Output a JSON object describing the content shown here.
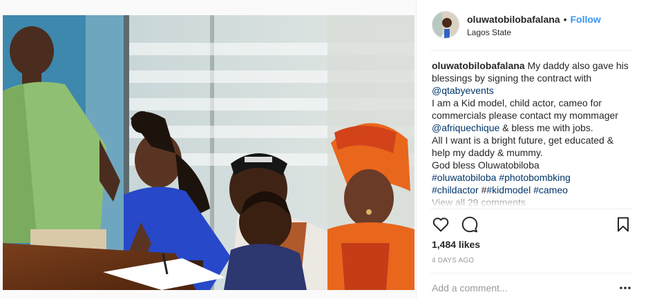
{
  "post": {
    "photo_description_icon": "photo-image",
    "header": {
      "username": "oluwatobilobafalana",
      "dot": "•",
      "follow_label": "Follow",
      "location": "Lagos State"
    },
    "caption": {
      "username": "oluwatobilobafalana",
      "text_1": " My daddy also gave his blessings by signing the contract with ",
      "mention_1": "@qtabyevents",
      "line_2": "I am a Kid model, child actor, cameo for commercials please contact my mommager ",
      "mention_2": "@afriquechique",
      "line_2_tail": " & bless me with jobs.",
      "line_3": "All I want is a bright future, get educated & help my daddy & mummy.",
      "line_4": "God bless Oluwatobiloba",
      "hashtag_1": "#oluwatobiloba",
      "hashtag_2": "#photobombking",
      "hashtag_3": "#childactor",
      "hash_prefix": "#",
      "hashtag_4": "#kidmodel",
      "hashtag_5": "#cameo",
      "view_all": "View all 29 comments"
    },
    "actions": {
      "like_icon": "heart-icon",
      "comment_icon": "comment-icon",
      "save_icon": "bookmark-icon"
    },
    "likes": "1,484 likes",
    "date": "4 DAYS AGO",
    "comment_placeholder": "Add a comment...",
    "more_icon": "more-options-icon",
    "colors": {
      "accent": "#3897f0",
      "link": "#003569",
      "muted": "#999999",
      "text": "#262626"
    }
  }
}
